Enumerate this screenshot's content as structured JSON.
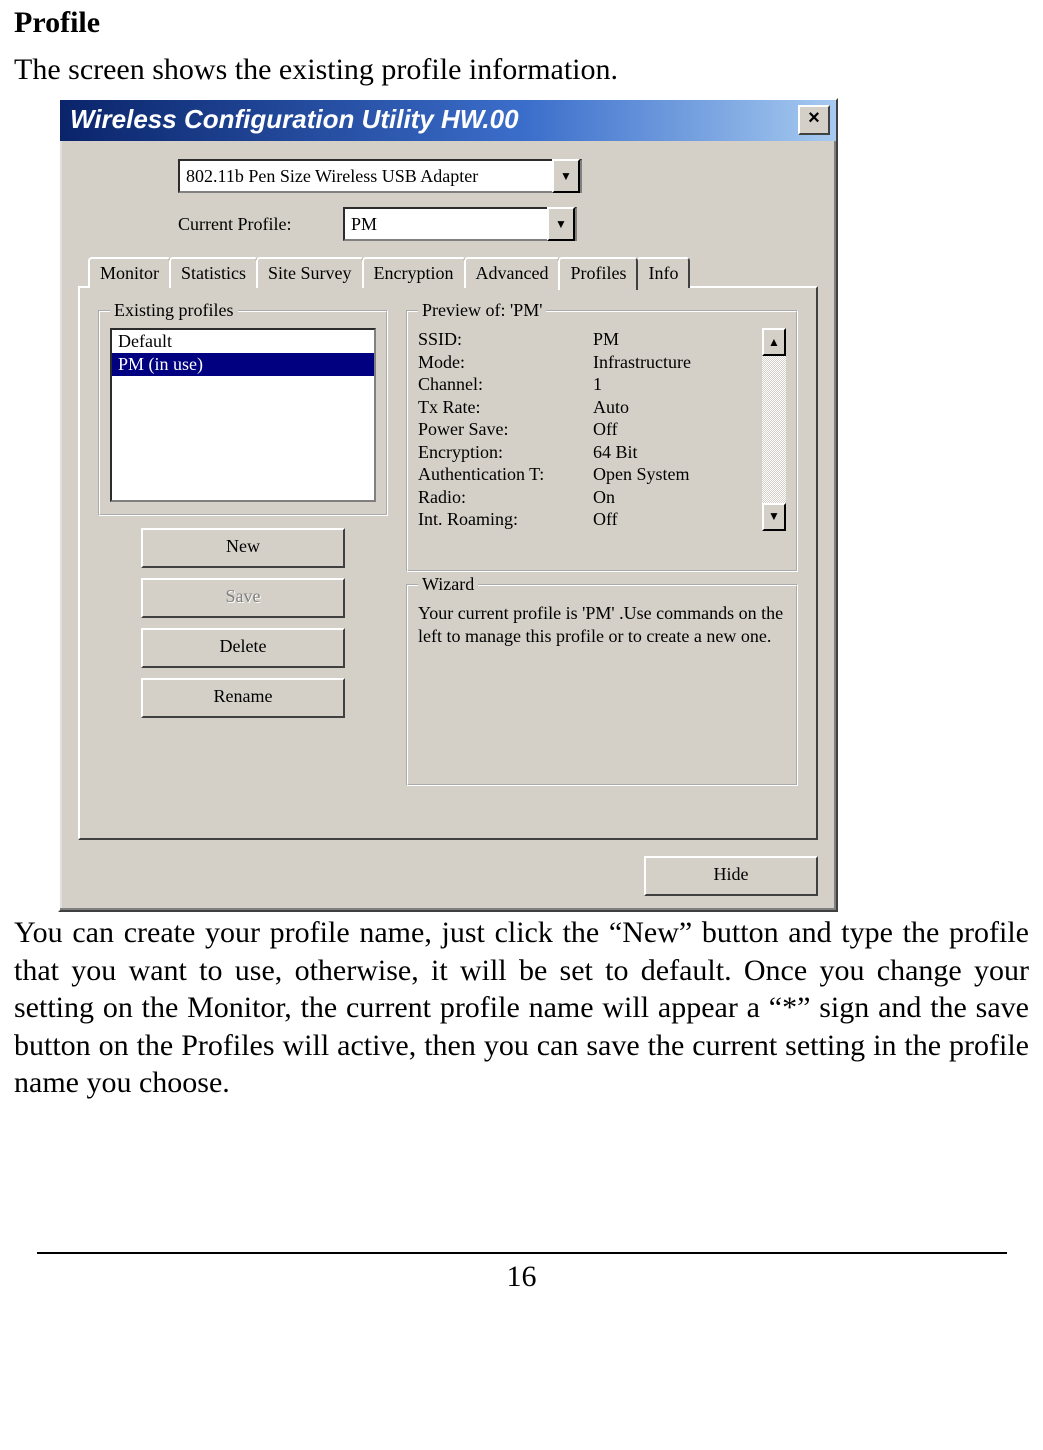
{
  "doc": {
    "heading": "Profile",
    "intro": "The screen shows the existing profile information.",
    "body": "You can create your profile name, just click the “New” button and type the profile that you want to use, otherwise, it will be set to default. Once you change your setting on the Monitor, the current profile name will appear a “*” sign and the save button on the Profiles will active, then you can save the current setting in the profile name you choose.",
    "page_number": "16"
  },
  "window": {
    "title": "Wireless Configuration Utility HW.00",
    "adapter": "802.11b Pen Size Wireless USB Adapter",
    "current_profile_label": "Current Profile:",
    "current_profile": "PM",
    "tabs": {
      "monitor": "Monitor",
      "statistics": "Statistics",
      "site_survey": "Site Survey",
      "encryption": "Encryption",
      "advanced": "Advanced",
      "profiles": "Profiles",
      "info": "Info"
    },
    "groups": {
      "existing": "Existing profiles",
      "preview": "Preview of: 'PM'",
      "wizard": "Wizard"
    },
    "list": {
      "default": "Default",
      "pm": "PM (in use)"
    },
    "buttons": {
      "new": "New",
      "save": "Save",
      "delete": "Delete",
      "rename": "Rename",
      "hide": "Hide"
    },
    "preview": {
      "ssid_k": "SSID:",
      "ssid_v": "PM",
      "mode_k": "Mode:",
      "mode_v": "Infrastructure",
      "channel_k": "Channel:",
      "channel_v": "1",
      "txrate_k": "Tx Rate:",
      "txrate_v": "Auto",
      "power_k": "Power Save:",
      "power_v": "Off",
      "enc_k": "Encryption:",
      "enc_v": "64 Bit",
      "auth_k": "Authentication T:",
      "auth_v": "Open System",
      "radio_k": "Radio:",
      "radio_v": "On",
      "roam_k": "Int. Roaming:",
      "roam_v": "Off"
    },
    "wizard_text": "Your current profile is  'PM' .Use commands on the left to manage this profile or to create a new one."
  }
}
